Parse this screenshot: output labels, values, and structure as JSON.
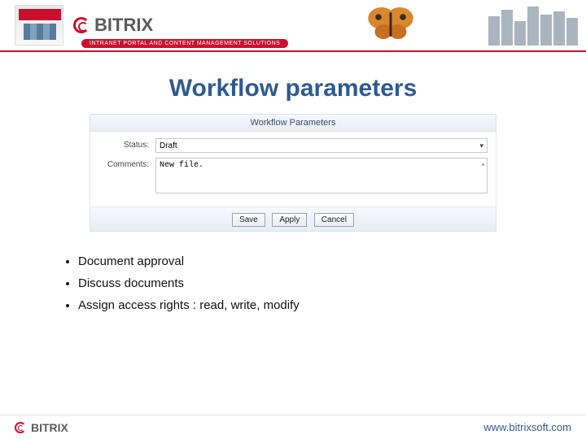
{
  "header": {
    "logo_text": "BITRIX",
    "tagline": "INTRANET PORTAL AND CONTENT MANAGEMENT SOLUTIONS"
  },
  "title": "Workflow parameters",
  "panel": {
    "header": "Workflow Parameters",
    "status_label": "Status:",
    "status_value": "Draft",
    "comments_label": "Comments:",
    "comments_value": "New file.",
    "buttons": {
      "save": "Save",
      "apply": "Apply",
      "cancel": "Cancel"
    }
  },
  "bullets": [
    "Document approval",
    "Discuss documents",
    "Assign access rights : read, write, modify"
  ],
  "footer": {
    "logo_text": "BITRIX",
    "url": "www.bitrixsoft.com"
  }
}
